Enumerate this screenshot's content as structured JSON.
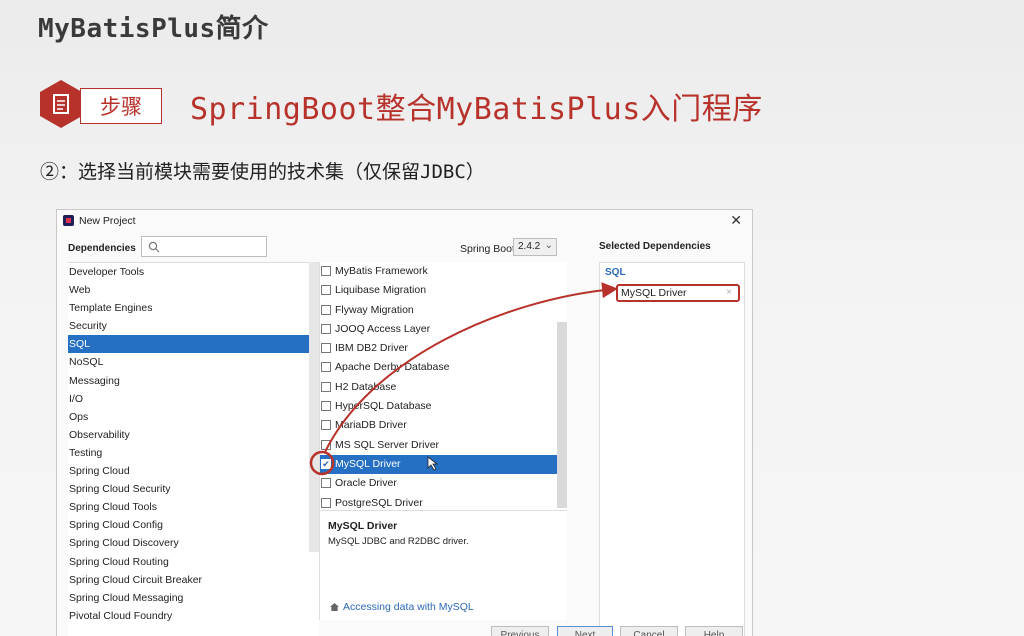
{
  "slide": {
    "title": "MyBatisPlus简介",
    "step_label": "步骤",
    "step_heading": "SpringBoot整合MyBatisPlus入门程序",
    "step_desc": "②：选择当前模块需要使用的技术集（仅保留JDBC）"
  },
  "dialog": {
    "title": "New Project",
    "dependencies_label": "Dependencies",
    "search_placeholder": "",
    "spring_boot_label": "Spring Boot",
    "spring_boot_version": "2.4.2",
    "selected_label": "Selected Dependencies",
    "categories": [
      "Developer Tools",
      "Web",
      "Template Engines",
      "Security",
      "SQL",
      "NoSQL",
      "Messaging",
      "I/O",
      "Ops",
      "Observability",
      "Testing",
      "Spring Cloud",
      "Spring Cloud Security",
      "Spring Cloud Tools",
      "Spring Cloud Config",
      "Spring Cloud Discovery",
      "Spring Cloud Routing",
      "Spring Cloud Circuit Breaker",
      "Spring Cloud Messaging",
      "Pivotal Cloud Foundry"
    ],
    "selected_category": "SQL",
    "dependencies": [
      {
        "label": "MyBatis Framework",
        "checked": false
      },
      {
        "label": "Liquibase Migration",
        "checked": false
      },
      {
        "label": "Flyway Migration",
        "checked": false
      },
      {
        "label": "JOOQ Access Layer",
        "checked": false
      },
      {
        "label": "IBM DB2 Driver",
        "checked": false
      },
      {
        "label": "Apache Derby Database",
        "checked": false
      },
      {
        "label": "H2 Database",
        "checked": false
      },
      {
        "label": "HyperSQL Database",
        "checked": false
      },
      {
        "label": "MariaDB Driver",
        "checked": false
      },
      {
        "label": "MS SQL Server Driver",
        "checked": false
      },
      {
        "label": "MySQL Driver",
        "checked": true
      },
      {
        "label": "Oracle Driver",
        "checked": false
      },
      {
        "label": "PostgreSQL Driver",
        "checked": false
      }
    ],
    "selected_dependency": "MySQL Driver",
    "detail": {
      "title": "MySQL Driver",
      "description": "MySQL JDBC and R2DBC driver.",
      "link": "Accessing data with MySQL"
    },
    "selected_group": "SQL",
    "selected_items": [
      "MySQL Driver"
    ],
    "remove_symbol": "×",
    "buttons": {
      "previous": "Previous",
      "next": "Next",
      "cancel": "Cancel",
      "help": "Help"
    }
  },
  "colors": {
    "accent_red": "#b8322c",
    "selection_blue": "#2670c4",
    "link_blue": "#2b68b8"
  }
}
